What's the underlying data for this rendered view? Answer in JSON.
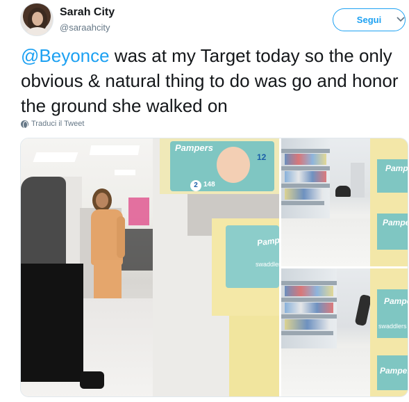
{
  "tweet": {
    "author_name": "Sarah City",
    "author_handle": "@saraahcity",
    "follow_label": "Segui",
    "mention": "@Beyonce",
    "text": " was at my Target today so the only obvious & natural thing to do was go and honor the ground she walked on",
    "translate_label": "Traduci il Tweet"
  },
  "icons": {
    "caret": "chevron-down-icon",
    "translate": "globe-icon"
  },
  "colors": {
    "accent": "#1da1f2",
    "text": "#14171a",
    "secondary": "#657786"
  },
  "media": {
    "product_labels": {
      "brand": "Pampers",
      "sub": "swaddlers",
      "count_main": "148",
      "size_main": "2",
      "size_alt": "12"
    }
  }
}
